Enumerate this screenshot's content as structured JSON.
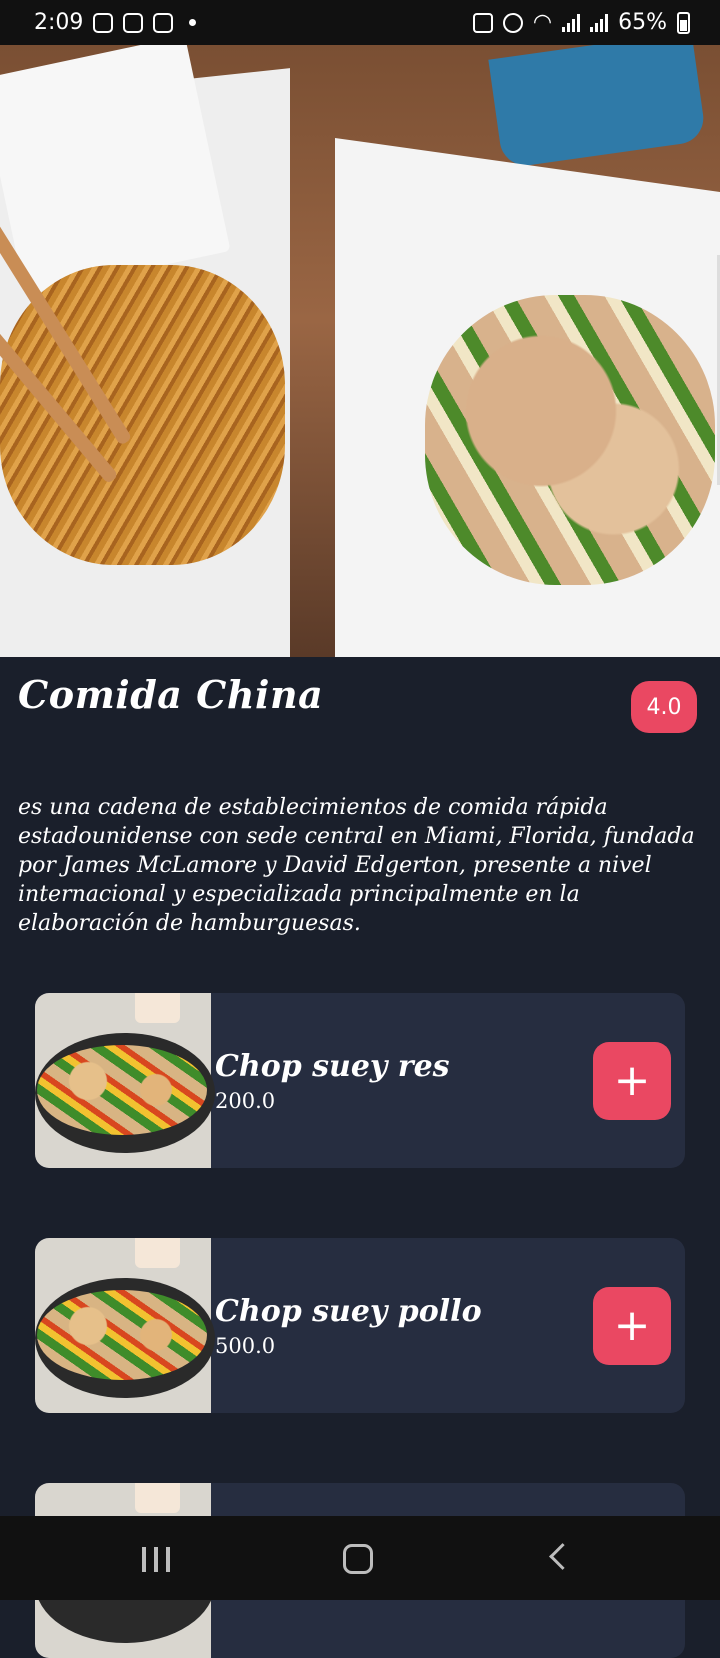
{
  "status_bar": {
    "time": "2:09",
    "battery": "65%"
  },
  "restaurant": {
    "name": "Comida China",
    "rating": "4.0",
    "description": "es una cadena de establecimientos de comida rápida estadounidense con sede central en Miami, Florida, fundada por James McLamore y David Edgerton, presente a nivel internacional y especializada principalmente en la elaboración de hamburguesas."
  },
  "menu": {
    "items": [
      {
        "name": "Chop suey res",
        "price": "200.0",
        "add_label": "+"
      },
      {
        "name": "Chop suey pollo",
        "price": "500.0",
        "add_label": "+"
      },
      {
        "name": "",
        "price": "",
        "add_label": ""
      }
    ]
  },
  "icons": {
    "status_left": [
      "voicemail-icon",
      "instagram-icon",
      "instagram-icon",
      "dot-icon"
    ],
    "status_right": [
      "battery-saver-icon",
      "alarm-icon",
      "wifi-icon",
      "signal-icon",
      "signal-icon",
      "battery-icon"
    ],
    "nav": [
      "recent-apps-icon",
      "home-icon",
      "back-icon"
    ]
  },
  "colors": {
    "background": "#1a1f2b",
    "card": "#262d40",
    "accent": "#ea4862"
  }
}
